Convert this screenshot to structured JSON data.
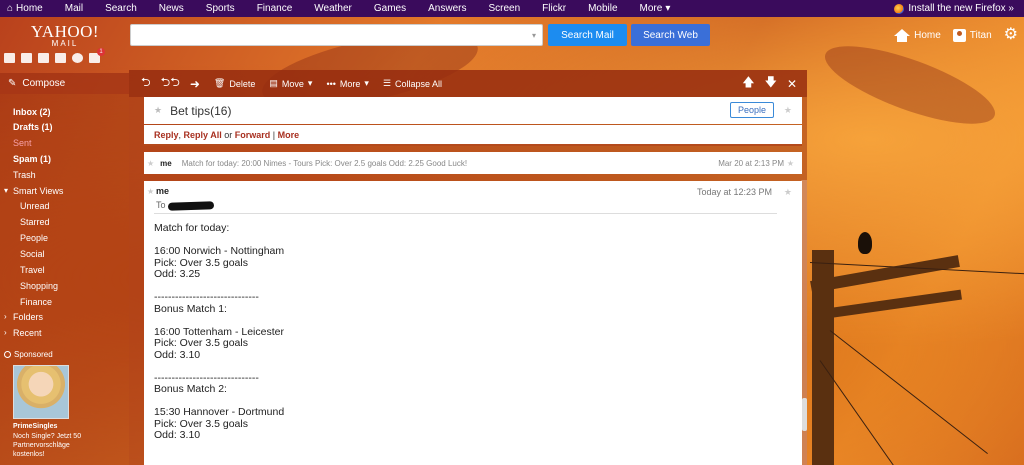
{
  "topnav": {
    "items": [
      "Home",
      "Mail",
      "Search",
      "News",
      "Sports",
      "Finance",
      "Weather",
      "Games",
      "Answers",
      "Screen",
      "Flickr",
      "Mobile",
      "More"
    ],
    "firefox": "Install the new Firefox »"
  },
  "logo": {
    "big": "YAHOO!",
    "small": "MAIL"
  },
  "search": {
    "value": "",
    "placeholder": ""
  },
  "header": {
    "search_mail": "Search Mail",
    "search_web": "Search Web",
    "home": "Home",
    "user": "Titan"
  },
  "app_icons": {
    "badge": "1"
  },
  "sidebar": {
    "compose": "Compose",
    "folders": [
      {
        "label": "Inbox (2)"
      },
      {
        "label": "Drafts (1)"
      },
      {
        "label": "Sent"
      },
      {
        "label": "Spam (1)"
      },
      {
        "label": "Trash"
      },
      {
        "label": "Smart Views"
      },
      {
        "label": "Unread"
      },
      {
        "label": "Starred"
      },
      {
        "label": "People"
      },
      {
        "label": "Social"
      },
      {
        "label": "Travel"
      },
      {
        "label": "Shopping"
      },
      {
        "label": "Finance"
      },
      {
        "label": "Folders"
      },
      {
        "label": "Recent"
      }
    ],
    "sponsored": "Sponsored",
    "ad_title": "PrimeSingles",
    "ad_text": "Noch Single? Jetzt 50 Partnervorschläge kostenlos!"
  },
  "toolbar": {
    "delete": "Delete",
    "move": "Move",
    "more": "More",
    "collapse_all": "Collapse All"
  },
  "conversation": {
    "subject": "Bet tips(16)",
    "people": "People",
    "reply": "Reply",
    "reply_all": "Reply All",
    "or": "or",
    "forward": "Forward",
    "sep": "|",
    "more": "More"
  },
  "collapsed_message": {
    "from": "me",
    "snippet": "Match for today: 20:00 Nimes - Tours Pick: Over 2.5 goals Odd: 2.25 Good Luck!",
    "date": "Mar 20 at 2:13 PM"
  },
  "open_message": {
    "from": "me",
    "to_label": "To",
    "date": "Today at 12:23 PM",
    "body": [
      "Match for today:",
      "",
      "16:00 Norwich - Nottingham",
      "Pick: Over 3.5 goals",
      "Odd: 3.25",
      "",
      "------------------------------",
      "Bonus Match 1:",
      "",
      "16:00 Tottenham - Leicester",
      "Pick: Over 3.5 goals",
      "Odd: 3.10",
      "",
      "------------------------------",
      "Bonus Match 2:",
      "",
      "15:30 Hannover - Dortmund",
      "Pick: Over 3.5 goals",
      "Odd: 3.10"
    ]
  }
}
